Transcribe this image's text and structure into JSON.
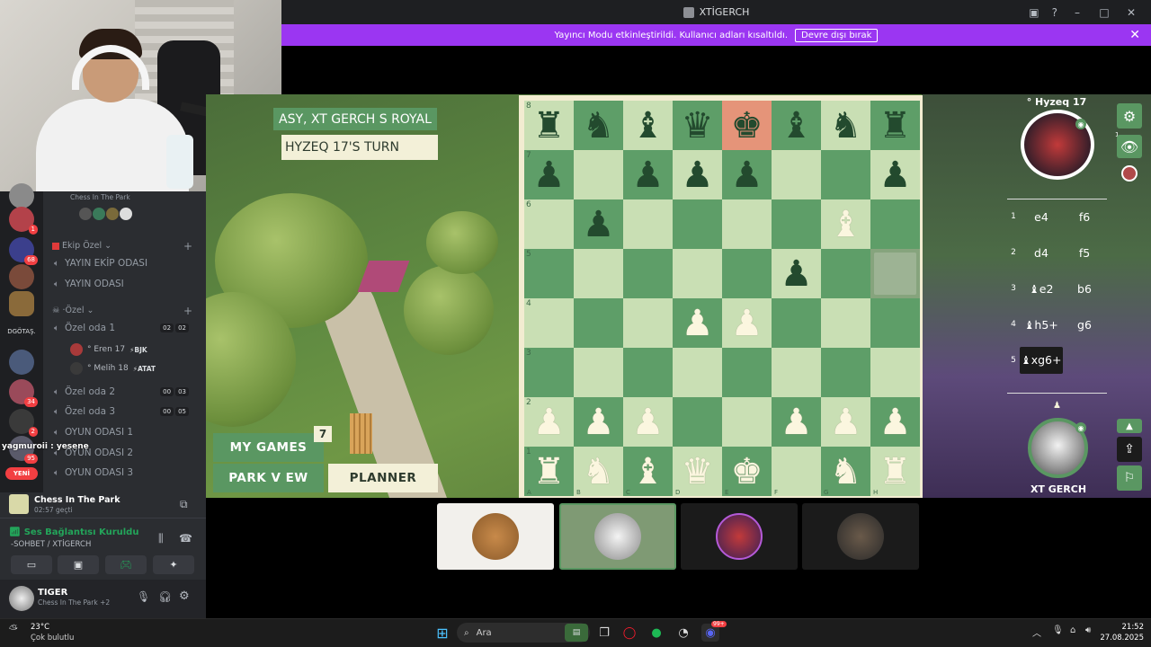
{
  "window": {
    "title": "XTİGERCH"
  },
  "banner": {
    "text": "Yayıncı Modu etkinleştirildi. Kullanıcı adları kısaltıldı.",
    "button": "Devre dışı bırak"
  },
  "sidebar": {
    "top_label": "Chess In The Park",
    "servers": [
      {
        "badge": "1"
      },
      {
        "badge": "68"
      },
      {
        "badge": ""
      },
      {
        "badge": ""
      },
      {
        "label": "DGÖTAŞ."
      },
      {
        "badge": ""
      },
      {
        "badge": "34"
      },
      {
        "badge": "2"
      },
      {
        "badge": "95"
      }
    ],
    "new_badge": "YENİ",
    "categories": [
      {
        "name": "Ekip Özel"
      },
      {
        "name": "·Özel"
      }
    ],
    "channels": [
      {
        "name": "YAYIN EKİP ODASI"
      },
      {
        "name": "YAYIN ODASI"
      },
      {
        "name": "Özel oda 1",
        "n1": "02",
        "n2": "02"
      },
      {
        "name": "Özel oda 2",
        "n1": "00",
        "n2": "03"
      },
      {
        "name": "Özel oda 3",
        "n1": "00",
        "n2": "05"
      },
      {
        "name": "OYUN ODASI 1"
      },
      {
        "name": "OYUN ODASI 2"
      },
      {
        "name": "OYUN ODASI 3"
      }
    ],
    "users": [
      {
        "name": "° Eren 17",
        "tag": "⚡BJK"
      },
      {
        "name": "° Melih 18",
        "tag": "⚡ATAT"
      }
    ],
    "chat_overlay": "yagmuroii : yesene",
    "activity": {
      "title": "Chess In The Park",
      "time": "02:57 geçti"
    },
    "voice": {
      "status": "Ses Bağlantısı Kuruldu",
      "channel": "-SOHBET / XTİGERCH"
    },
    "user": {
      "name": "TIGER",
      "status": "Chess In The Park +2"
    }
  },
  "game": {
    "title": "ASY, XT GERCH  S ROYAL",
    "turn": "HYZEQ 17'S TURN",
    "buttons": {
      "my_games": "MY GAMES",
      "park_view": "PARK V EW",
      "planner": "PLANNER"
    },
    "games_count": "7",
    "ranks": [
      "8",
      "7",
      "6",
      "5",
      "4",
      "3",
      "2",
      "1"
    ],
    "files": [
      "A",
      "B",
      "C",
      "D",
      "E",
      "F",
      "G",
      "H"
    ]
  },
  "board": [
    [
      "br",
      "bn",
      "bb",
      "bq",
      "bk",
      "bb",
      "bn",
      "br"
    ],
    [
      "bp",
      "",
      "bp",
      "bp",
      "bp",
      "",
      "",
      "bp"
    ],
    [
      "",
      "bp",
      "",
      "",
      "",
      "",
      "wb",
      ""
    ],
    [
      "",
      "",
      "",
      "",
      "",
      "bp",
      "",
      ""
    ],
    [
      "",
      "",
      "",
      "wp",
      "wp",
      "",
      "",
      ""
    ],
    [
      "",
      "",
      "",
      "",
      "",
      "",
      "",
      ""
    ],
    [
      "wp",
      "wp",
      "wp",
      "",
      "",
      "wp",
      "wp",
      "wp"
    ],
    [
      "wr",
      "wn",
      "wb",
      "wq",
      "wk",
      "",
      "wn",
      "wr"
    ]
  ],
  "highlights": {
    "last_king": "e8",
    "selected": "h5"
  },
  "opponent": {
    "name": "° Hyzeq 17",
    "badge": "1"
  },
  "player": {
    "name": "XT GERCH"
  },
  "moves": [
    {
      "n": "1",
      "w": "e4",
      "b": "f6"
    },
    {
      "n": "2",
      "w": "d4",
      "b": "f5"
    },
    {
      "n": "3",
      "w": "♝e2",
      "b": "b6"
    },
    {
      "n": "4",
      "w": "♝h5+",
      "b": "g6"
    },
    {
      "n": "5",
      "w": "♝xg6+",
      "b": ""
    }
  ],
  "taskbar": {
    "weather_temp": "23°C",
    "weather_desc": "Çok bulutlu",
    "search": "Ara",
    "time": "21:52",
    "date": "27.08.2025",
    "discord_badge": "99+"
  },
  "colors": {
    "accent": "#5a9762",
    "banner": "#9b36f2",
    "light_sq": "#c9dfb4",
    "dark_sq": "#5e9e68"
  }
}
